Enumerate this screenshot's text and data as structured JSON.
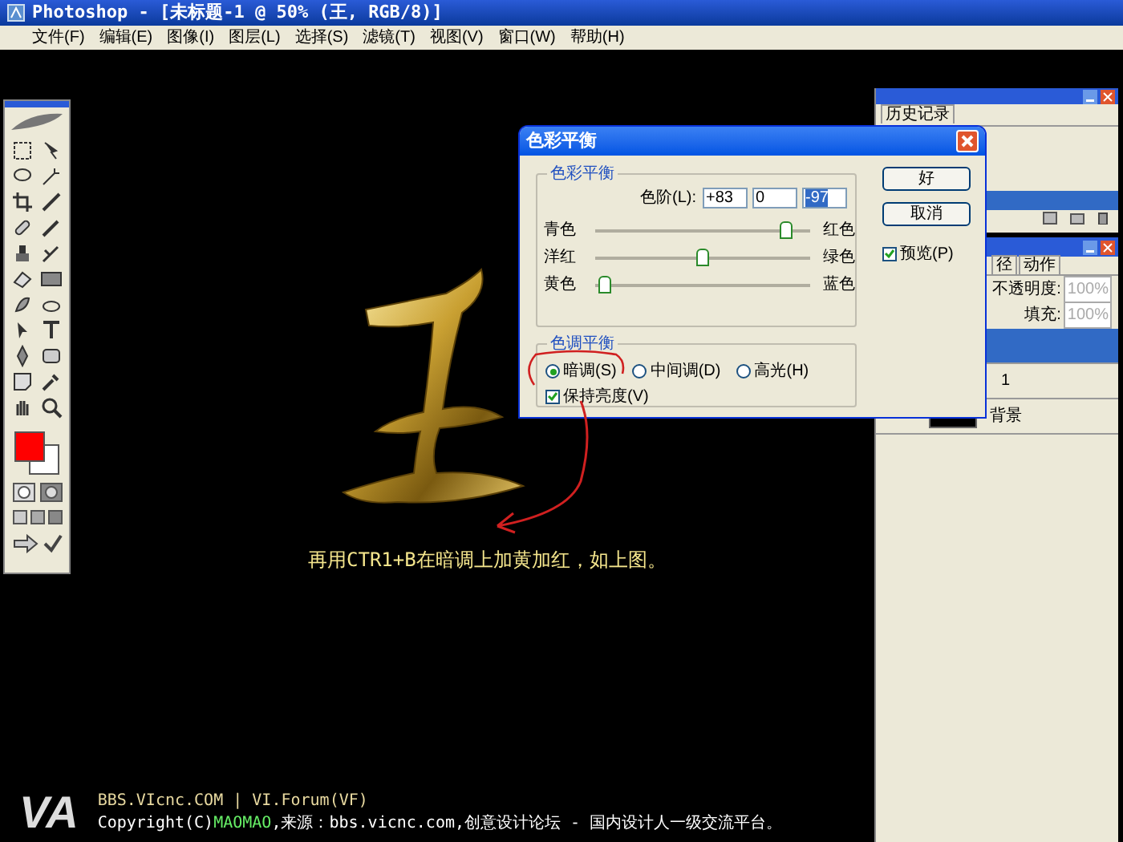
{
  "window": {
    "title": "Photoshop - [未标题-1 @ 50% (王, RGB/8)]"
  },
  "menu": [
    "文件(F)",
    "编辑(E)",
    "图像(I)",
    "图层(L)",
    "选择(S)",
    "滤镜(T)",
    "视图(V)",
    "窗口(W)",
    "帮助(H)"
  ],
  "dialog": {
    "title": "色彩平衡",
    "color_group": "色彩平衡",
    "levels_label": "色阶(L):",
    "levels": [
      {
        "value": "+83",
        "selected": false
      },
      {
        "value": "0",
        "selected": false
      },
      {
        "value": "-97",
        "selected": true
      }
    ],
    "sliders": [
      {
        "left": "青色",
        "right": "红色",
        "level": 0.915
      },
      {
        "left": "洋红",
        "right": "绿色",
        "level": 0.5
      },
      {
        "left": "黄色",
        "right": "蓝色",
        "level": 0.015
      }
    ],
    "tone_group": "色调平衡",
    "tones": [
      {
        "label": "暗调(S)",
        "selected": true
      },
      {
        "label": "中间调(D)",
        "selected": false
      },
      {
        "label": "高光(H)",
        "selected": false
      }
    ],
    "preserve": {
      "label": "保持亮度(V)",
      "checked": true
    },
    "buttons": [
      "好",
      "取消"
    ],
    "preview": {
      "label": "预览(P)",
      "checked": true
    }
  },
  "history_panel": {
    "tab": "历史记录"
  },
  "layers_panel": {
    "tabs": [
      "径",
      "动作"
    ],
    "opacity_label": "不透明度:",
    "opacity": "100%",
    "fill_label": "填充:",
    "fill": "100%",
    "layers": [
      {
        "selected": true
      },
      {
        "name": "1",
        "selected": false
      },
      {
        "name": "背景",
        "selected": false
      }
    ]
  },
  "caption": "再用CTR1+B在暗调上加黄加红，如上图。",
  "footer": {
    "logo": "VA",
    "line1": "BBS.VIcnc.COM | VI.Forum(VF)",
    "copyright": "Copyright(C)",
    "author": "MAOMAO",
    "source": ",来源：bbs.vicnc.com,创意设计论坛 - 国内设计人一级交流平台。"
  }
}
